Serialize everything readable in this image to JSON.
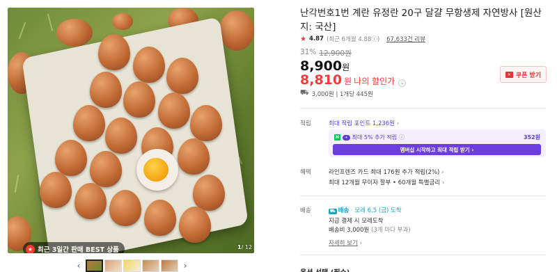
{
  "product": {
    "title": "난각번호1번 계란 유정란 20구 달걀 무항생제 자연방사 [원산지: 국산]",
    "rating": "4.87",
    "rating_recent": "(최근 6개월 4.88",
    "rating_recent_end": ")",
    "info_icon": "ⓘ",
    "review_count": "67,633건 리뷰",
    "discount_rate": "31%",
    "original_price": "12,900원",
    "price": "8,900",
    "price_unit": "원",
    "my_price": "8,810",
    "my_price_unit": "원",
    "my_price_label": "나의 할인가",
    "coupon_button": "쿠폰 받기",
    "shipping": "3,000원 | 1개당 445원"
  },
  "gallery": {
    "badge_text": "최근 3일간 판매 BEST 상품",
    "page_current": "1",
    "page_total": "/ 12",
    "prev_arrow": "‹",
    "next_arrow": "›",
    "thumb_count": 5
  },
  "points": {
    "label": "적립",
    "max_points": "최대 적립 포인트 1,236원",
    "npay_text": "최대 5% 추가 적립",
    "npay_value": "352원",
    "membership_button": "멤버십 시작하고 최대 적립 받기"
  },
  "benefits": {
    "label": "혜택",
    "line1": "라인프렌즈 카드 최대 176원 추가 적립(2%)",
    "line2": "최대 12개월 무이자 할부 • 60개월 특별금리"
  },
  "delivery": {
    "label": "배송",
    "badge": "배송",
    "date": "모레 6.5 (금) 도착",
    "line2": "지금 결제 시 모레도착",
    "fee": "배송비 3,000원",
    "fee_note": "(3개 마다 부과)",
    "detail_link": "자세히 보기"
  },
  "options": {
    "label": "옵션 선택 (필수)"
  },
  "colors": {
    "accent_red": "#f23c3c",
    "accent_purple": "#6c3ce0",
    "delivery_blue": "#1aa4c2"
  }
}
